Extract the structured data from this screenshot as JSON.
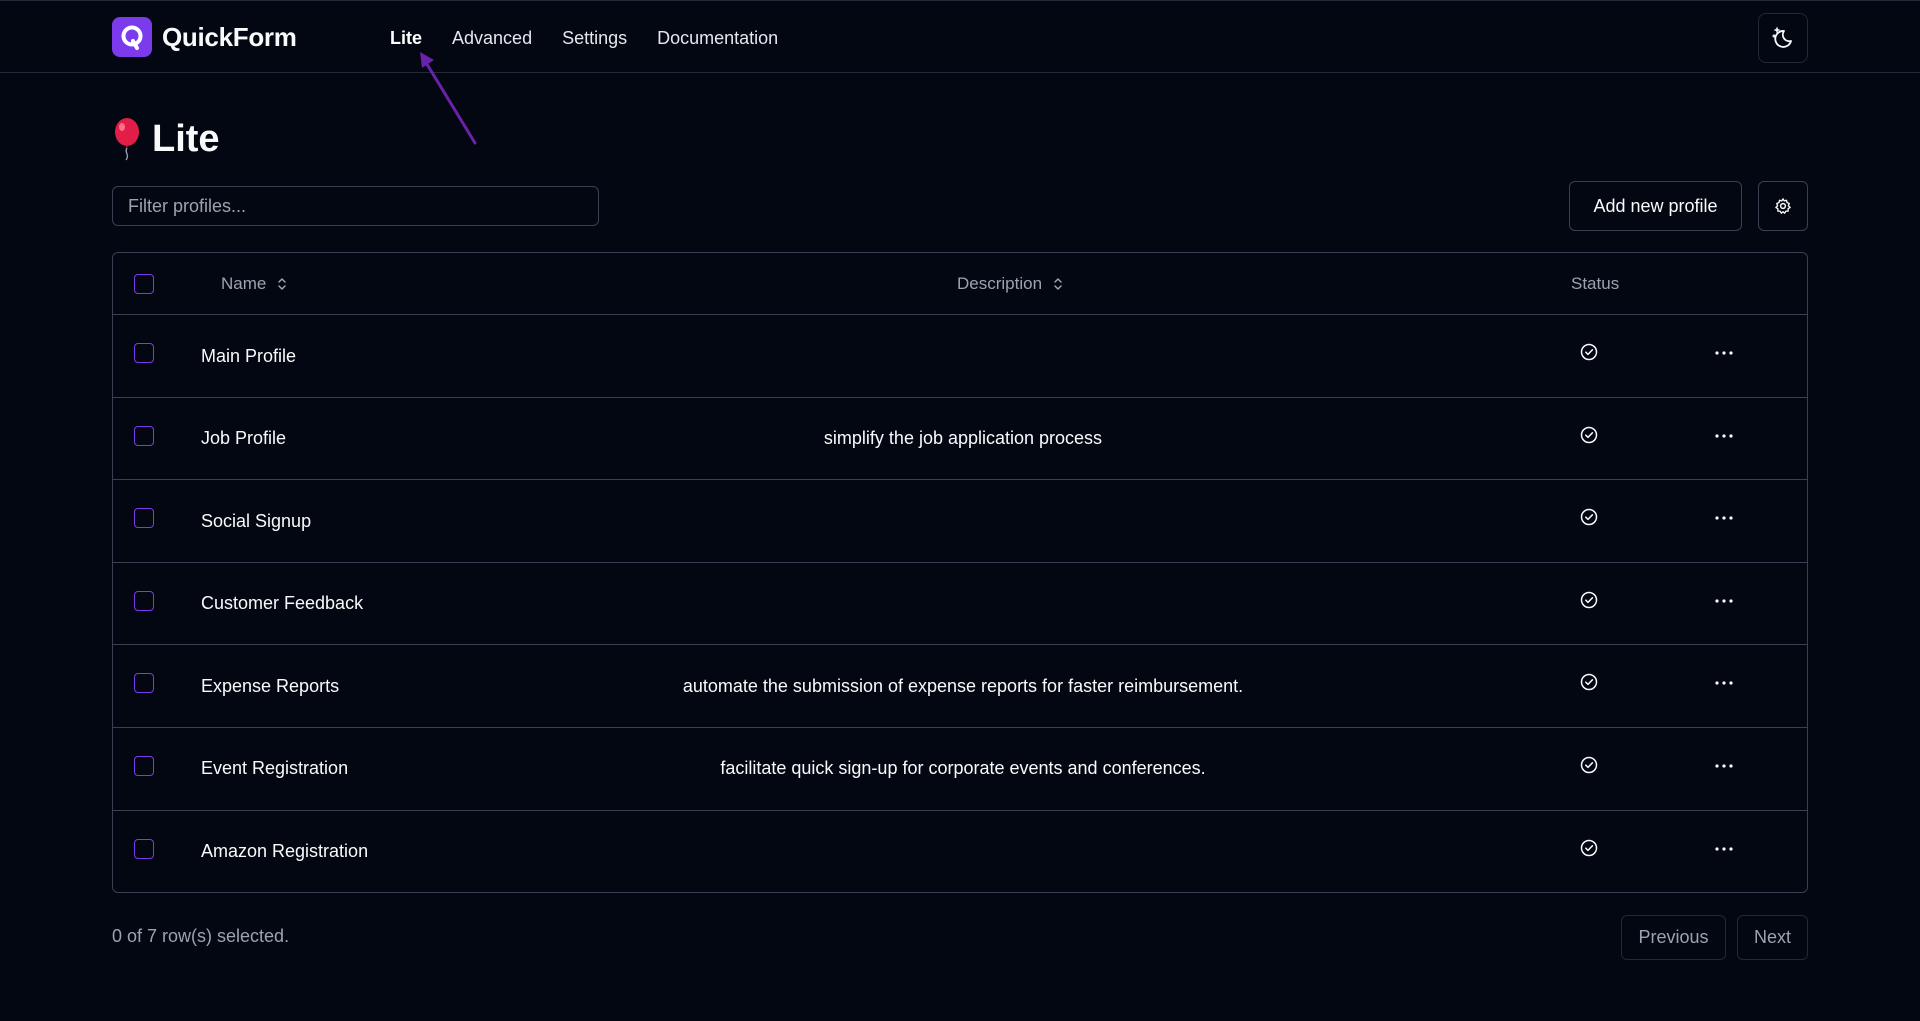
{
  "brand": {
    "name": "QuickForm",
    "logo_icon": "q-logo-icon",
    "accent": "#7c3aed"
  },
  "nav": {
    "items": [
      {
        "label": "Lite",
        "active": true
      },
      {
        "label": "Advanced",
        "active": false
      },
      {
        "label": "Settings",
        "active": false
      },
      {
        "label": "Documentation",
        "active": false
      }
    ],
    "theme_toggle_icon": "moon-stars-icon"
  },
  "page": {
    "title": "Lite",
    "title_icon": "balloon-icon"
  },
  "toolbar": {
    "filter_placeholder": "Filter profiles...",
    "add_label": "Add new profile",
    "settings_icon": "gear-icon"
  },
  "table": {
    "columns": {
      "name": "Name",
      "description": "Description",
      "status": "Status"
    },
    "rows": [
      {
        "name": "Main Profile",
        "description": ""
      },
      {
        "name": "Job Profile",
        "description": "simplify the job application process"
      },
      {
        "name": "Social Signup",
        "description": ""
      },
      {
        "name": "Customer Feedback",
        "description": ""
      },
      {
        "name": "Expense Reports",
        "description": "automate the submission of expense reports for faster reimbursement."
      },
      {
        "name": "Event Registration",
        "description": "facilitate quick sign-up for corporate events and conferences."
      },
      {
        "name": "Amazon Registration",
        "description": ""
      }
    ]
  },
  "footer": {
    "selection_text": "0 of 7 row(s) selected.",
    "previous_label": "Previous",
    "next_label": "Next"
  },
  "annotation": {
    "arrow_color": "#6b21a8"
  }
}
